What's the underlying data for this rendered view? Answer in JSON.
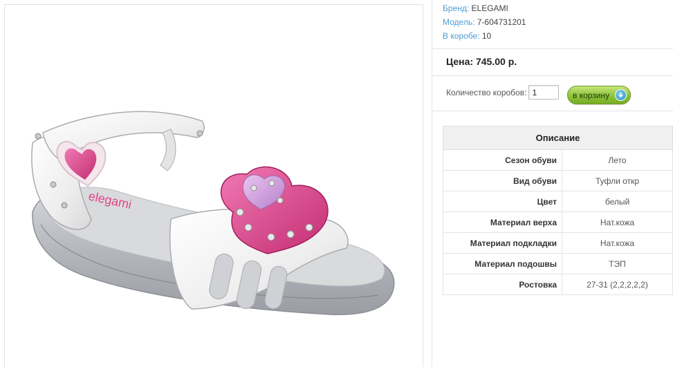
{
  "product": {
    "image_alt": "Детские сандалии ELEGAMI белые с розовым сердцем",
    "logo_text": "elegami"
  },
  "meta": {
    "brand_label": "Бренд:",
    "brand_value": "ELEGAMI",
    "model_label": "Модель:",
    "model_value": "7-604731201",
    "box_label": "В коробе:",
    "box_value": "10"
  },
  "price": {
    "text": "Цена: 745.00 р."
  },
  "order": {
    "qty_label": "Количество коробов:",
    "qty_value": "1",
    "cart_label": "в корзину"
  },
  "description": {
    "header": "Описание",
    "rows": [
      {
        "key": "Сезон обуви",
        "value": "Лето"
      },
      {
        "key": "Вид обуви",
        "value": "Туфли откр"
      },
      {
        "key": "Цвет",
        "value": "белый"
      },
      {
        "key": "Материал верха",
        "value": "Нат.кожа"
      },
      {
        "key": "Материал подкладки",
        "value": "Нат.кожа"
      },
      {
        "key": "Материал подошвы",
        "value": "ТЭП"
      },
      {
        "key": "Ростовка",
        "value": "27-31 (2,2,2,2,2)"
      }
    ]
  },
  "colors": {
    "link_blue": "#4a9ed6",
    "cart_green": "#8dc33a",
    "heart_pink": "#e0458a"
  }
}
